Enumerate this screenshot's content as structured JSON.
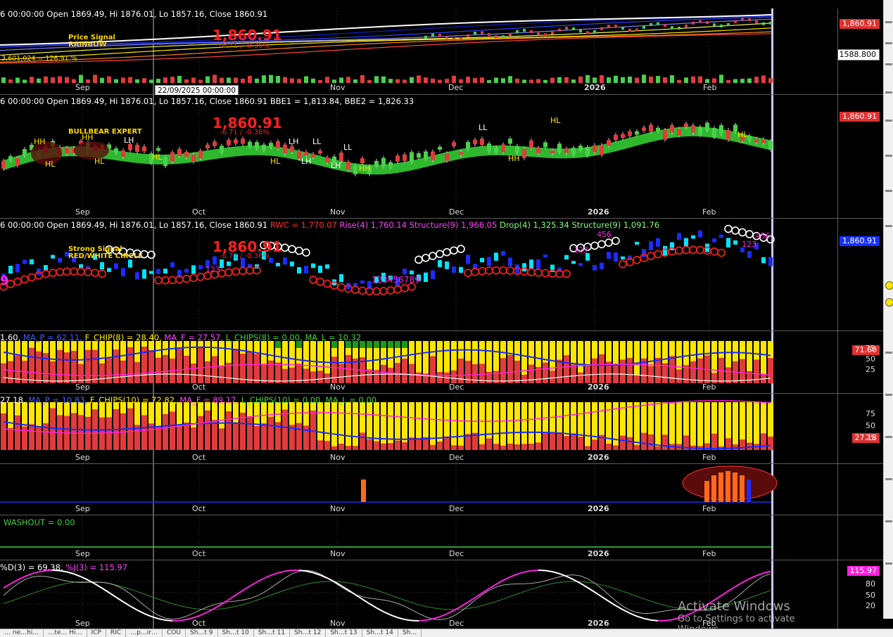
{
  "colors": {
    "bull": "#4ad14a",
    "bear": "#e23b3b",
    "yellow": "#ffe600",
    "blue": "#1a2cff",
    "magenta": "#ff20e0",
    "cyan": "#00e5ff",
    "white": "#ffffff",
    "grid": "#3c3c3c",
    "cursor": "#c8c8ff"
  },
  "months": [
    "Sep",
    "Oct",
    "Nov",
    "Dec",
    "2026",
    "Feb"
  ],
  "pane1": {
    "header": "6 00:00:00 Open 1869.49, Hi 1876.01, Lo 1857.16, Close 1860.91",
    "signal_title": "Price Signal",
    "signal_sub": "RAINBOW",
    "left_note": "3,601,024 = 126.91 %",
    "big_price": "1,860.91",
    "small_change": "-6.71 / -0.36%",
    "price_tag": "1,860.91",
    "secondary_tag": "1588.800",
    "months": [
      "Sep",
      "Nov",
      "Dec",
      "2026",
      "Feb"
    ]
  },
  "cursor_date": "22/09/2025 00:00:00",
  "pane2": {
    "header": "6 00:00:00 Open 1869.49, Hi 1876.01, Lo 1857.16, Close 1860.91 BBE1 = 1,813.84, BBE2 = 1,826.33",
    "signal_title": "BULLBEAR EXPERT",
    "big_price": "1,860.91",
    "small_change": "-6.71 / -0.36%",
    "price_tag": "1,860.91",
    "pivots": [
      "HH",
      "HL",
      "HH",
      "HL",
      "LH",
      "HL",
      "HL",
      "LH",
      "LH",
      "LL",
      "LH",
      "LL",
      "HH",
      "LL",
      "HH",
      "HL",
      "HL"
    ]
  },
  "pane3": {
    "header_a": "6 00:00:00 Open 1869.49, Hi 1876.01, Lo 1857.16, Close 1860.91",
    "rwc": "RWC = 1,770.07",
    "rise": "Rise(4) 1,760.14 Structure(9) 1,966.05",
    "drop": "Drop(4) 1,325.34 Structure(9) 1,091.76",
    "signal_title": "Strong Signal",
    "signal_sub": "RED/WHITE CIRCLE",
    "big_price": "1,860.91",
    "small_change": "-6.71 / -0.36%",
    "price_tag": "1,860.91",
    "count_a": "123",
    "count_b": "123456789",
    "count_c": "123",
    "count_d": "456",
    "count_e": "123",
    "count_f": "456",
    "nine": "9"
  },
  "pane4": {
    "parts": [
      "1.60, ",
      "MA_P = 62.11, ",
      "F_CHIP(8) = 28.40, ",
      "MA_F = 27.57, ",
      "L_CHIPS(8) = 0.00, MA_L = 10.32"
    ],
    "tag": "71.60",
    "ticks": [
      "75",
      "50",
      "25"
    ]
  },
  "pane5": {
    "parts": [
      "27.18, ",
      "MA_P = 10.83, ",
      "F_CHIPS(10) = 72.82, ",
      "MA_F = 89.17, ",
      "L_CHIPS(10) = 0.00, MA_L = 0.00"
    ],
    "tag": "27.18",
    "ticks": [
      "75",
      "50",
      "25"
    ]
  },
  "pane7": {
    "header": "WASHOUT = 0.00"
  },
  "pane8": {
    "header_a": "%D(3) = 69.38, ",
    "header_b": "%J(3) = 115.97",
    "tag": "115.97",
    "ticks": [
      "80",
      "50",
      "20"
    ]
  },
  "tabs": [
    "… ne…hi…",
    "…te… Hi…",
    "ICP",
    "RIC",
    "…p…ir…",
    "COU",
    "Sh…t 9",
    "Sh…t 10",
    "Sh…t 11",
    "Sh…t 12",
    "Sh…t 13",
    "Sh…t 14",
    "Sh…"
  ],
  "watermark": {
    "line1": "Activate Windows",
    "line2": "Go to Settings to activate Windows."
  }
}
